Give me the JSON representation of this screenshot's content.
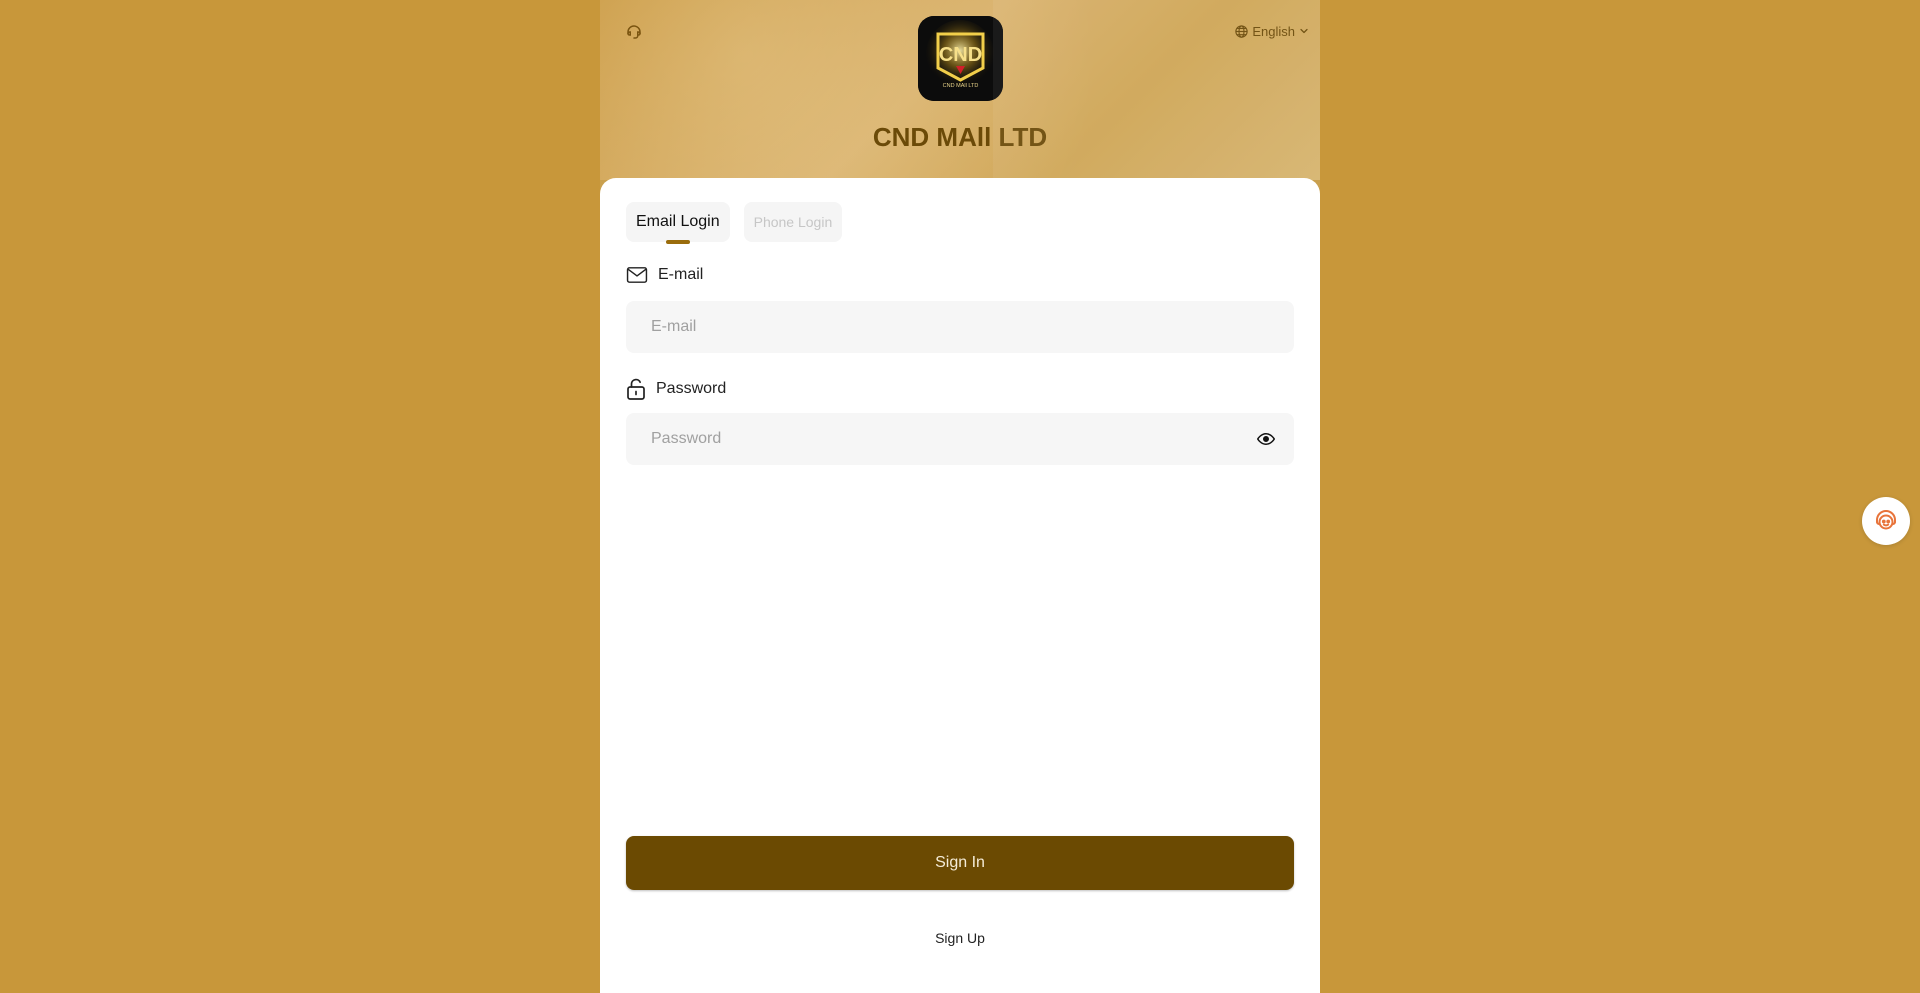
{
  "header": {
    "language": "English",
    "brand_name": "CND MAll LTD",
    "logo_text": "CND",
    "logo_subtext": "CND MAll LTD"
  },
  "tabs": [
    {
      "label": "Email Login",
      "active": true
    },
    {
      "label": "Phone Login",
      "active": false
    }
  ],
  "email": {
    "label": "E-mail",
    "placeholder": "E-mail",
    "value": ""
  },
  "password": {
    "label": "Password",
    "placeholder": "Password",
    "value": ""
  },
  "actions": {
    "sign_in": "Sign In",
    "sign_up": "Sign Up"
  },
  "icons": {
    "support_top": "headset-icon",
    "language": "globe-icon",
    "dropdown": "chevron-down-icon",
    "email": "envelope-icon",
    "password": "lock-icon",
    "toggle_visibility": "eye-icon",
    "floating_service": "customer-service-icon"
  },
  "colors": {
    "page_background": "#c8973a",
    "brand_text": "#6b4a08",
    "primary_button": "#6b4a02",
    "tab_indicator": "#9a6c0c"
  }
}
